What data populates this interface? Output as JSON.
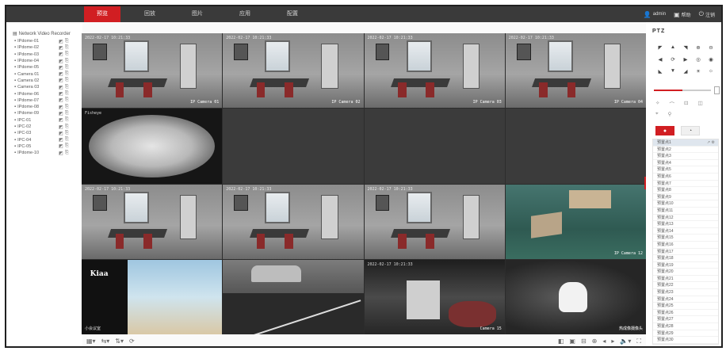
{
  "topnav": {
    "tabs": [
      {
        "label": "预览",
        "active": true
      },
      {
        "label": "回放",
        "active": false
      },
      {
        "label": "图片",
        "active": false
      },
      {
        "label": "应用",
        "active": false
      },
      {
        "label": "配置",
        "active": false
      }
    ],
    "user": "admin",
    "help": "帮助",
    "logout": "注销"
  },
  "sidebar": {
    "root_label": "Network Video Recorder",
    "cameras": [
      "IPdome-01",
      "IPdome-02",
      "IPdome-03",
      "IPdome-04",
      "IPdome-05",
      "Camera 01",
      "Camera 02",
      "Camera 03",
      "IPdome-06",
      "IPdome-07",
      "IPdome-08",
      "IPdome-09",
      "IPC-01",
      "IPC-02",
      "IPC-03",
      "IPC-04",
      "IPC-05",
      "IPdome-10"
    ]
  },
  "tiles": [
    {
      "type": "room",
      "osd": "2022-02-17 10:21:33",
      "br": "IP Camera 01"
    },
    {
      "type": "room",
      "osd": "2022-02-17 10:21:33",
      "br": "IP Camera 02"
    },
    {
      "type": "room",
      "osd": "2022-02-17 10:21:33",
      "br": "IP Camera 03"
    },
    {
      "type": "room",
      "osd": "2022-02-17 10:21:33",
      "br": "IP Camera 04"
    },
    {
      "type": "fisheye",
      "osd": "Fisheye",
      "br": ""
    },
    {
      "type": "empty"
    },
    {
      "type": "empty"
    },
    {
      "type": "empty"
    },
    {
      "type": "room",
      "osd": "2022-02-17 10:21:33",
      "br": ""
    },
    {
      "type": "room",
      "osd": "2022-02-17 10:21:33",
      "br": ""
    },
    {
      "type": "room",
      "osd": "2022-02-17 10:21:33",
      "br": ""
    },
    {
      "type": "outdoor",
      "osd": "",
      "br": "IP Camera 12"
    },
    {
      "type": "split",
      "logo": "Kiaa",
      "wm": "小会议室"
    },
    {
      "type": "street",
      "osd": "",
      "br": ""
    },
    {
      "type": "hallway",
      "osd": "2022-02-17 10:21:33",
      "br": "Camera 15"
    },
    {
      "type": "thermal",
      "osd": "",
      "br": "热成像摄像头"
    }
  ],
  "ptz": {
    "title": "PTZ",
    "presets": [
      "预置点1",
      "预置点2",
      "预置点3",
      "预置点4",
      "预置点5",
      "预置点6",
      "预置点7",
      "预置点8",
      "预置点9",
      "预置点10",
      "预置点11",
      "预置点12",
      "预置点13",
      "预置点14",
      "预置点15",
      "预置点16",
      "预置点17",
      "预置点18",
      "预置点19",
      "预置点20",
      "预置点21",
      "预置点22",
      "预置点23",
      "预置点24",
      "预置点25",
      "预置点26",
      "预置点27",
      "预置点28",
      "预置点29",
      "预置点30"
    ]
  },
  "colors": {
    "accent": "#d11e22",
    "topbar": "#3a3a3a",
    "empty_tile": "#3b3b3b"
  }
}
